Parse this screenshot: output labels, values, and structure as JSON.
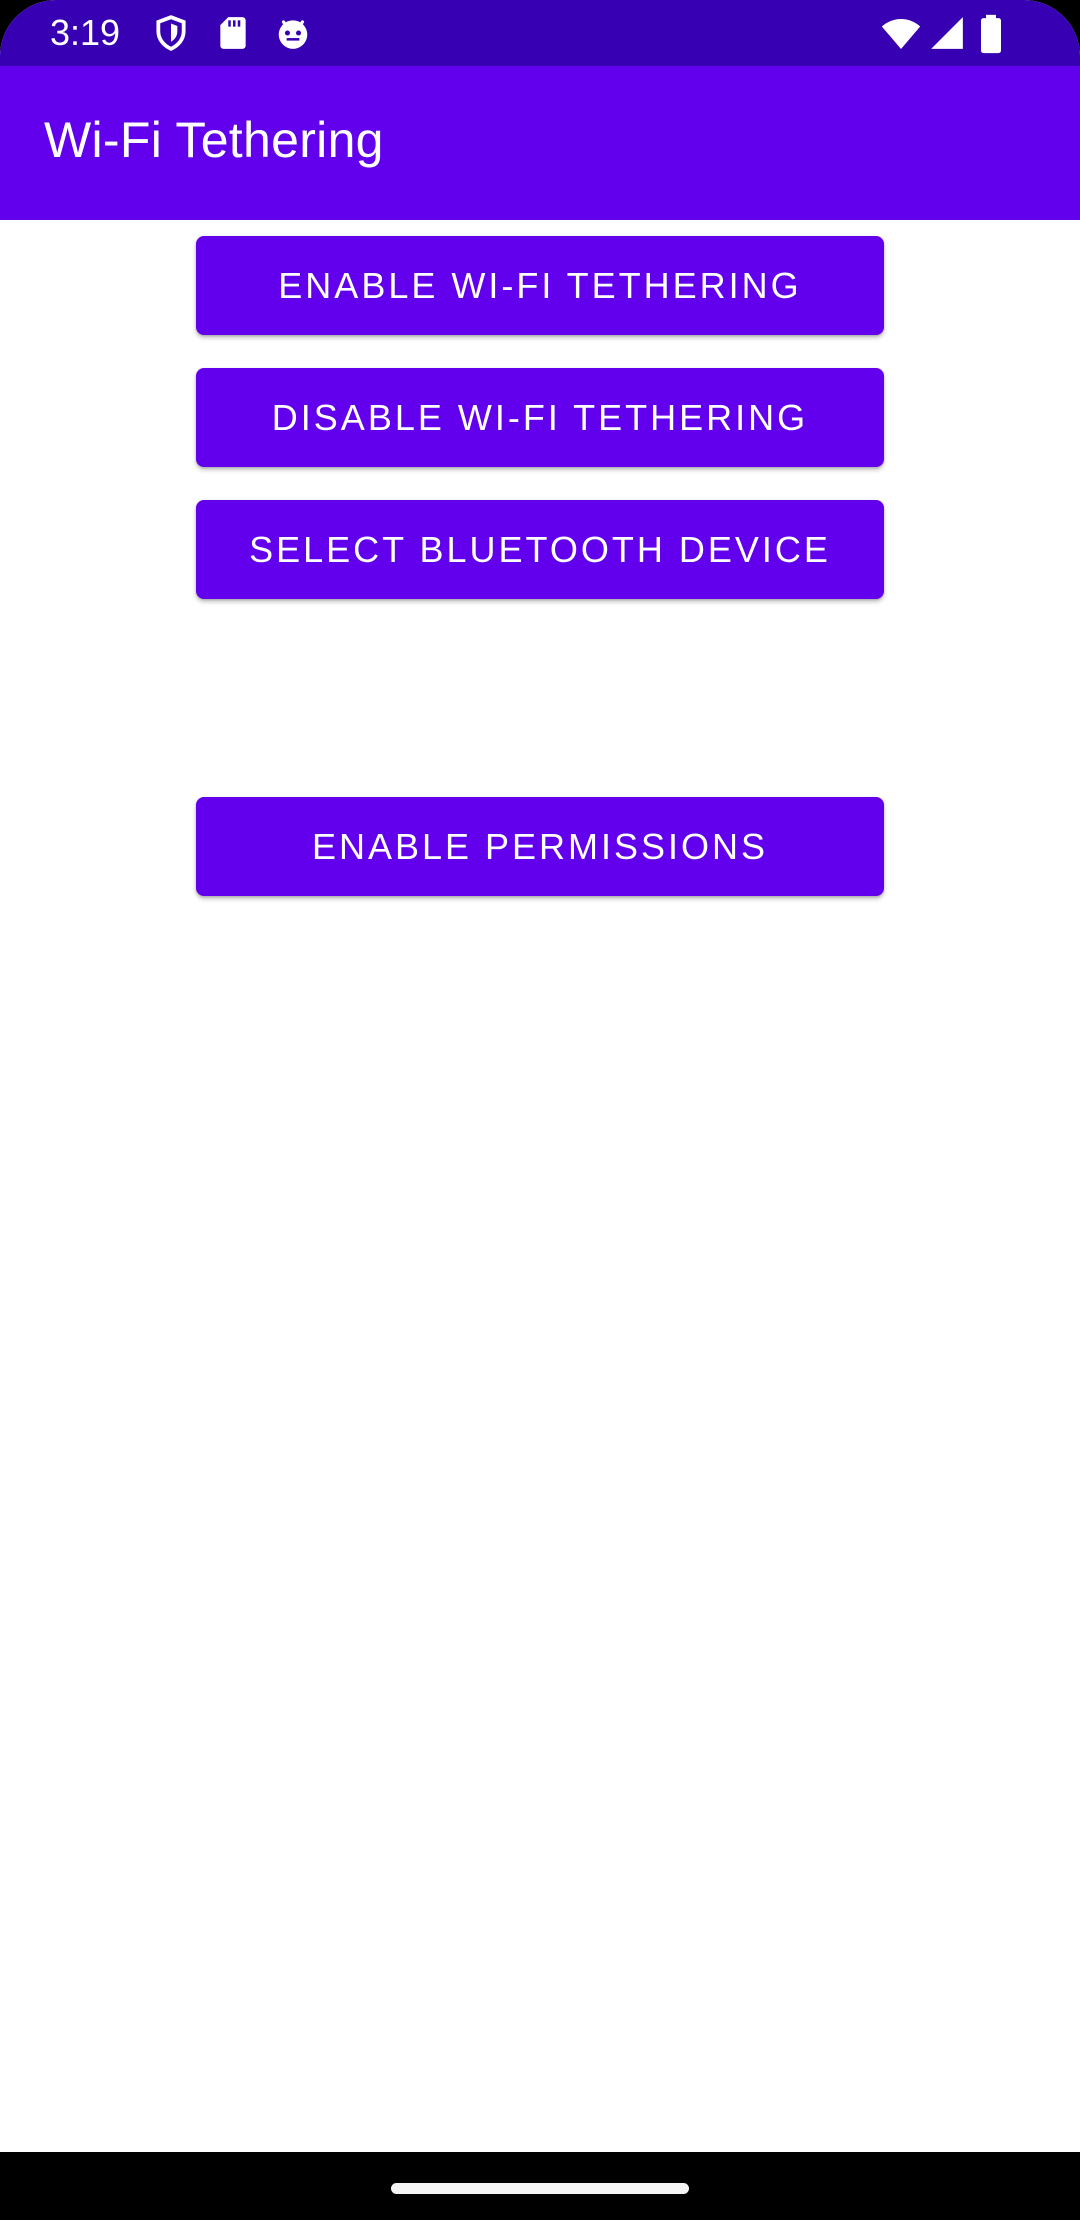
{
  "status_bar": {
    "time": "3:19",
    "left_icons": [
      "shield-icon",
      "sd-card-icon",
      "android-face-icon"
    ],
    "right_icons": [
      "wifi-icon",
      "cell-signal-icon",
      "battery-icon"
    ]
  },
  "app_bar": {
    "title": "Wi-Fi Tethering"
  },
  "buttons": {
    "enable_tethering": "ENABLE WI-FI TETHERING",
    "disable_tethering": "DISABLE WI-FI TETHERING",
    "select_bluetooth": "SELECT BLUETOOTH DEVICE",
    "enable_permissions": "ENABLE PERMISSIONS"
  },
  "colors": {
    "status_bar": "#3700b3",
    "primary": "#6200ee",
    "background": "#ffffff",
    "button_text": "#ffffff"
  }
}
